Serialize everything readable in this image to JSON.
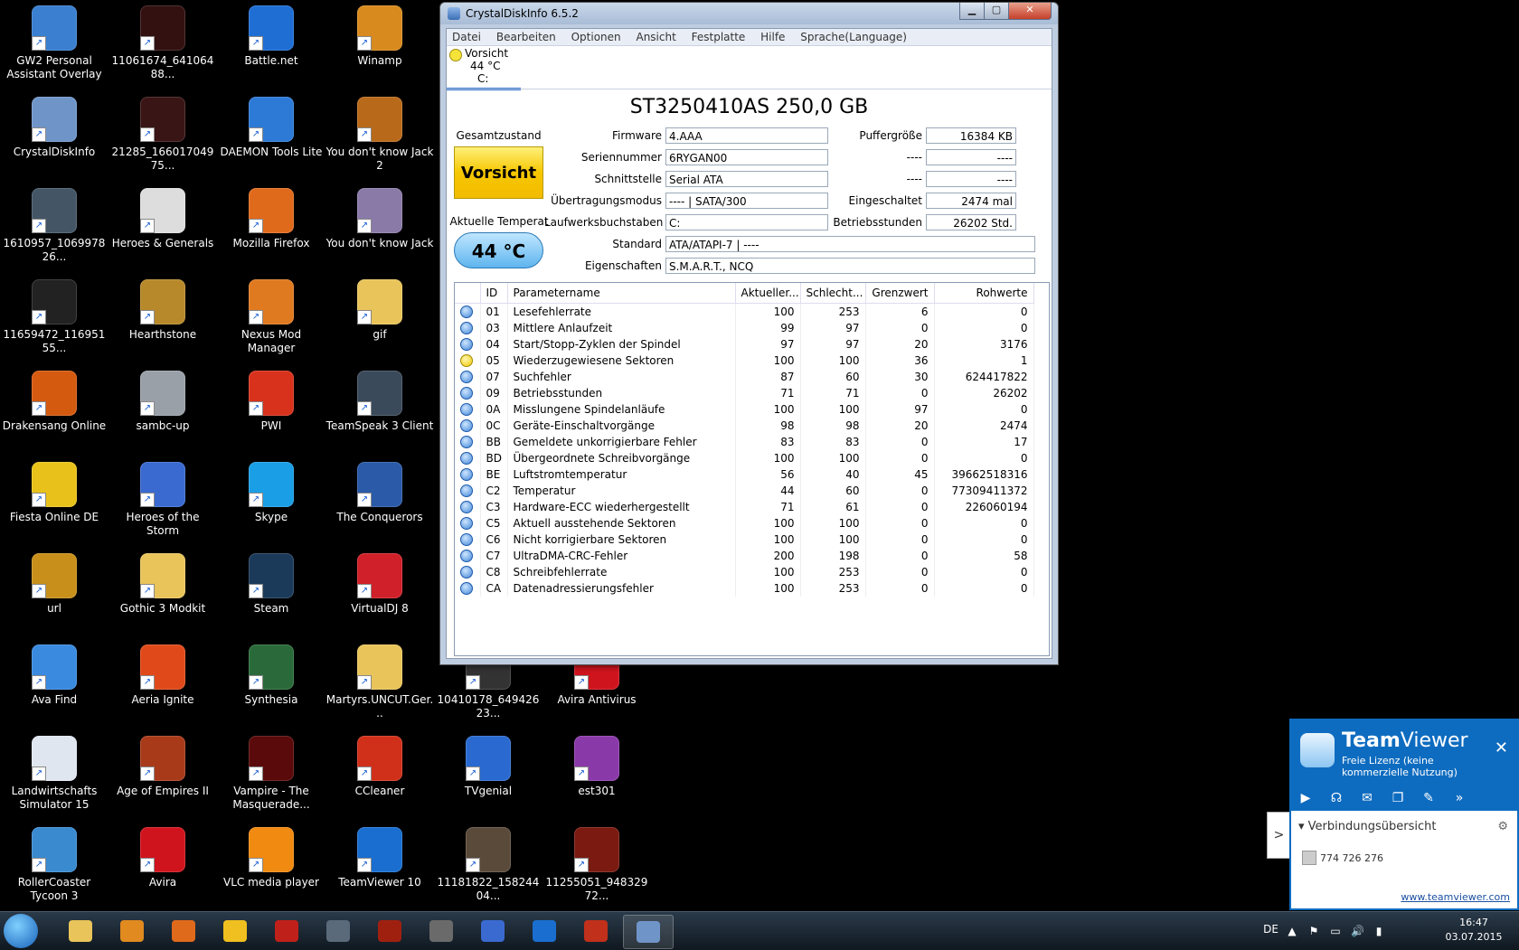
{
  "desktop": {
    "icons": [
      {
        "label": "GW2 Personal Assistant Overlay",
        "color": "#3a7fd0"
      },
      {
        "label": "11061674_64106488...",
        "color": "#331111"
      },
      {
        "label": "Battle.net",
        "color": "#1f6ed4"
      },
      {
        "label": "Winamp",
        "color": "#d88a1e"
      },
      {
        "label": "CrystalDiskInfo",
        "color": "#6f95c8"
      },
      {
        "label": "21285_16601704975...",
        "color": "#3a1515"
      },
      {
        "label": "DAEMON Tools Lite",
        "color": "#2d7ad6"
      },
      {
        "label": "You don't know Jack 2",
        "color": "#b86a1a"
      },
      {
        "label": "1610957_106997826...",
        "color": "#445566"
      },
      {
        "label": "Heroes & Generals",
        "color": "#dddddd"
      },
      {
        "label": "Mozilla Firefox",
        "color": "#e06a1c"
      },
      {
        "label": "You don't know Jack",
        "color": "#8a7aa8"
      },
      {
        "label": "11659472_11695155...",
        "color": "#222222"
      },
      {
        "label": "Hearthstone",
        "color": "#b8892a"
      },
      {
        "label": "Nexus Mod Manager",
        "color": "#e07a20"
      },
      {
        "label": "gif",
        "color": "#e8c45a"
      },
      {
        "label": "Drakensang Online",
        "color": "#d45a10"
      },
      {
        "label": "sambc-up",
        "color": "#9aa0a8"
      },
      {
        "label": "PWI",
        "color": "#d8321c"
      },
      {
        "label": "TeamSpeak 3 Client",
        "color": "#3a4a5a"
      },
      {
        "label": "Fiesta Online DE",
        "color": "#e8c21a"
      },
      {
        "label": "Heroes of the Storm",
        "color": "#3a6ad0"
      },
      {
        "label": "Skype",
        "color": "#1a9ee6"
      },
      {
        "label": "The Conquerors",
        "color": "#2a5aa8"
      },
      {
        "label": "url",
        "color": "#c8901a"
      },
      {
        "label": "Gothic 3 Modkit",
        "color": "#e8c45a"
      },
      {
        "label": "Steam",
        "color": "#1b3a5a"
      },
      {
        "label": "VirtualDJ 8",
        "color": "#d0202a"
      },
      {
        "label": "Ava Find",
        "color": "#3a8ae0"
      },
      {
        "label": "Aeria Ignite",
        "color": "#e04a1a"
      },
      {
        "label": "Synthesia",
        "color": "#2a6a3a"
      },
      {
        "label": "Martyrs.UNCUT.Ger...",
        "color": "#e8c45a"
      },
      {
        "label": "10410178_64942623...",
        "color": "#333333"
      },
      {
        "label": "Avira Antivirus",
        "color": "#d0141e"
      },
      {
        "label": "Landwirtschafts Simulator 15",
        "color": "#e0e6f0"
      },
      {
        "label": "Age of Empires II",
        "color": "#a83a1a"
      },
      {
        "label": "Vampire - The Masquerade...",
        "color": "#5a0a0a"
      },
      {
        "label": "CCleaner",
        "color": "#d0301a"
      },
      {
        "label": "TVgenial",
        "color": "#2a6ad0"
      },
      {
        "label": "est301",
        "color": "#8a3aa8"
      },
      {
        "label": "RollerCoaster Tycoon 3",
        "color": "#3a8ad0"
      },
      {
        "label": "Avira",
        "color": "#d0141e"
      },
      {
        "label": "VLC media player",
        "color": "#f08a10"
      },
      {
        "label": "TeamViewer 10",
        "color": "#1a6ed0"
      },
      {
        "label": "11181822_15824404...",
        "color": "#5a4a3a"
      },
      {
        "label": "11255051_94832972...",
        "color": "#7a1a10"
      }
    ]
  },
  "cdi": {
    "title": "CrystalDiskInfo 6.5.2",
    "window_controls": {
      "minimize": "▁",
      "maximize": "▢",
      "close": "✕"
    },
    "menu": [
      "Datei",
      "Bearbeiten",
      "Optionen",
      "Ansicht",
      "Festplatte",
      "Hilfe",
      "Sprache(Language)"
    ],
    "disk_tab": {
      "status": "Vorsicht",
      "temp": "44 °C",
      "letter": "C:"
    },
    "drive_title": "ST3250410AS 250,0 GB",
    "health_label": "Gesamtzustand",
    "health_value": "Vorsicht",
    "temp_label": "Aktuelle Temperat",
    "temp_value": "44 °C",
    "fields": {
      "firmware": {
        "label": "Firmware",
        "value": "4.AAA"
      },
      "serial": {
        "label": "Seriennummer",
        "value": "6RYGAN00"
      },
      "interface": {
        "label": "Schnittstelle",
        "value": "Serial ATA"
      },
      "transfer": {
        "label": "Übertragungsmodus",
        "value": "---- | SATA/300"
      },
      "letters": {
        "label": "Laufwerksbuchstaben",
        "value": "C:"
      },
      "standard": {
        "label": "Standard",
        "value": "ATA/ATAPI-7 | ----"
      },
      "features": {
        "label": "Eigenschaften",
        "value": "S.M.A.R.T., NCQ"
      },
      "buffer": {
        "label": "Puffergröße",
        "value": "16384 KB"
      },
      "blank1": {
        "label": "----",
        "value": "----"
      },
      "blank2": {
        "label": "----",
        "value": "----"
      },
      "power_count": {
        "label": "Eingeschaltet",
        "value": "2474 mal"
      },
      "power_hours": {
        "label": "Betriebsstunden",
        "value": "26202 Std."
      }
    },
    "smart_headers": [
      "ID",
      "Parametername",
      "Aktueller...",
      "Schlecht...",
      "Grenzwert",
      "Rohwerte"
    ],
    "smart_rows": [
      [
        "01",
        "Lesefehlerrate",
        "100",
        "253",
        "6",
        "0"
      ],
      [
        "03",
        "Mittlere Anlaufzeit",
        "99",
        "97",
        "0",
        "0"
      ],
      [
        "04",
        "Start/Stopp-Zyklen der Spindel",
        "97",
        "97",
        "20",
        "3176"
      ],
      [
        "05",
        "Wiederzugewiesene Sektoren",
        "100",
        "100",
        "36",
        "1"
      ],
      [
        "07",
        "Suchfehler",
        "87",
        "60",
        "30",
        "624417822"
      ],
      [
        "09",
        "Betriebsstunden",
        "71",
        "71",
        "0",
        "26202"
      ],
      [
        "0A",
        "Misslungene Spindelanläufe",
        "100",
        "100",
        "97",
        "0"
      ],
      [
        "0C",
        "Geräte-Einschaltvorgänge",
        "98",
        "98",
        "20",
        "2474"
      ],
      [
        "BB",
        "Gemeldete unkorrigierbare Fehler",
        "83",
        "83",
        "0",
        "17"
      ],
      [
        "BD",
        "Übergeordnete Schreibvorgänge",
        "100",
        "100",
        "0",
        "0"
      ],
      [
        "BE",
        "Luftstromtemperatur",
        "56",
        "40",
        "45",
        "39662518316"
      ],
      [
        "C2",
        "Temperatur",
        "44",
        "60",
        "0",
        "77309411372"
      ],
      [
        "C3",
        "Hardware-ECC wiederhergestellt",
        "71",
        "61",
        "0",
        "226060194"
      ],
      [
        "C5",
        "Aktuell ausstehende Sektoren",
        "100",
        "100",
        "0",
        "0"
      ],
      [
        "C6",
        "Nicht korrigierbare Sektoren",
        "100",
        "100",
        "0",
        "0"
      ],
      [
        "C7",
        "UltraDMA-CRC-Fehler",
        "200",
        "198",
        "0",
        "58"
      ],
      [
        "C8",
        "Schreibfehlerrate",
        "100",
        "253",
        "0",
        "0"
      ],
      [
        "CA",
        "Datenadressierungsfehler",
        "100",
        "253",
        "0",
        "0"
      ]
    ],
    "warn_row_id": "05"
  },
  "teamviewer": {
    "brand_bold": "Team",
    "brand_rest": "Viewer",
    "subtitle": "Freie Lizenz (keine kommerzielle Nutzung)",
    "close": "✕",
    "tools": [
      "▶",
      "☊",
      "✉",
      "❐",
      "✎",
      "»"
    ],
    "section": "Verbindungsübersicht",
    "section_arrow": "▾",
    "settings": "⚙",
    "partner_id": "774 726 276",
    "link": "www.teamviewer.com",
    "toggle": ">"
  },
  "taskbar": {
    "apps": [
      {
        "name": "explorer",
        "color": "#e8c45a"
      },
      {
        "name": "media-player",
        "color": "#e08a20"
      },
      {
        "name": "firefox",
        "color": "#e06a1c"
      },
      {
        "name": "messenger",
        "color": "#f0c020"
      },
      {
        "name": "gw2",
        "color": "#c0201a"
      },
      {
        "name": "teamspeak",
        "color": "#5a6a7a"
      },
      {
        "name": "diablo",
        "color": "#a02010"
      },
      {
        "name": "origin",
        "color": "#6a6a6a"
      },
      {
        "name": "s3",
        "color": "#3a6ad0"
      },
      {
        "name": "teamviewer",
        "color": "#1a6ed0"
      },
      {
        "name": "pwi",
        "color": "#c0301a"
      },
      {
        "name": "crystaldiskinfo",
        "color": "#6f95c8"
      }
    ],
    "active_app": "crystaldiskinfo",
    "lang": "DE",
    "tray_icons": [
      "▲",
      "⚑",
      "▭",
      "🔊",
      "▮"
    ],
    "time": "16:47",
    "date": "03.07.2015"
  }
}
